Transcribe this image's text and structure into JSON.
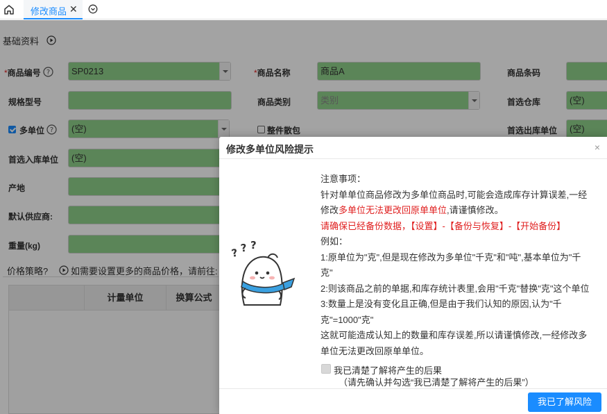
{
  "tabs": {
    "active_label": "修改商品",
    "close_glyph": "✕"
  },
  "section": {
    "title": "基础资料"
  },
  "fields": {
    "product_code": {
      "label": "商品编号",
      "value": "SP0213"
    },
    "product_name": {
      "label": "商品名称",
      "value": "商品A"
    },
    "barcode": {
      "label": "商品条码",
      "value": ""
    },
    "spec": {
      "label": "规格型号",
      "value": ""
    },
    "category": {
      "label": "商品类别",
      "placeholder": "类别"
    },
    "pref_warehouse": {
      "label": "首选仓库",
      "value": "(空)"
    },
    "multi_unit": {
      "label": "多单位",
      "value": "(空)",
      "checked": true
    },
    "whole_loose": {
      "label": "整件散包",
      "checked": false
    },
    "pref_out_unit": {
      "label": "首选出库单位",
      "value": "(空)"
    },
    "pref_in_unit": {
      "label": "首选入库单位",
      "value": "(空)"
    },
    "origin": {
      "label": "产地",
      "value": ""
    },
    "default_supplier": {
      "label": "默认供应商:",
      "value": ""
    },
    "weight": {
      "label": "重量(kg)",
      "value": ""
    }
  },
  "price_strategy": {
    "label": "价格策略?",
    "hint": "如需要设置更多的商品价格，请前往:"
  },
  "table": {
    "columns": [
      "计量单位",
      "换算公式"
    ]
  },
  "modal": {
    "title": "修改多单位风险提示",
    "close_glyph": "×",
    "notice_title": "注意事项：",
    "para1_a": "针对单单位商品修改为多单位商品时,可能会造成库存计算误差,一经修改",
    "para1_red": "多单位无法更改回原单单位",
    "para1_b": ",请谨慎修改。",
    "backup_prefix": "请确保已经备份数据，",
    "backup_path": "【设置】-【备份与恢复】-【开始备份】",
    "example_title": "例如：",
    "ex1": "1:原单位为\"克\",但是现在修改为多单位\"千克\"和\"吨\",基本单位为\"千克\"",
    "ex2": "2:则该商品之前的单据,和库存统计表里,会用\"千克\"替换\"克\"这个单位",
    "ex3": "3:数量上是没有变化且正确,但是由于我们认知的原因,认为\"千克\"=1000\"克\"",
    "conclusion": "这就可能造成认知上的数量和库存误差,所以请谨慎修改,一经修改多单位无法更改回原单单位。",
    "ack_label": "我已清楚了解将产生的后果",
    "ack_hint": "（请先确认并勾选“我已清楚了解将产生的后果”）",
    "confirm_label": "我已了解风险"
  },
  "colors": {
    "accent": "#1a8cff",
    "field_bg": "#8fd08a",
    "warning_red": "#e02020"
  },
  "icons": [
    "home-icon",
    "chevron-circle-down-icon",
    "play-circle-icon",
    "help-circle-icon",
    "mascot-illustration"
  ]
}
